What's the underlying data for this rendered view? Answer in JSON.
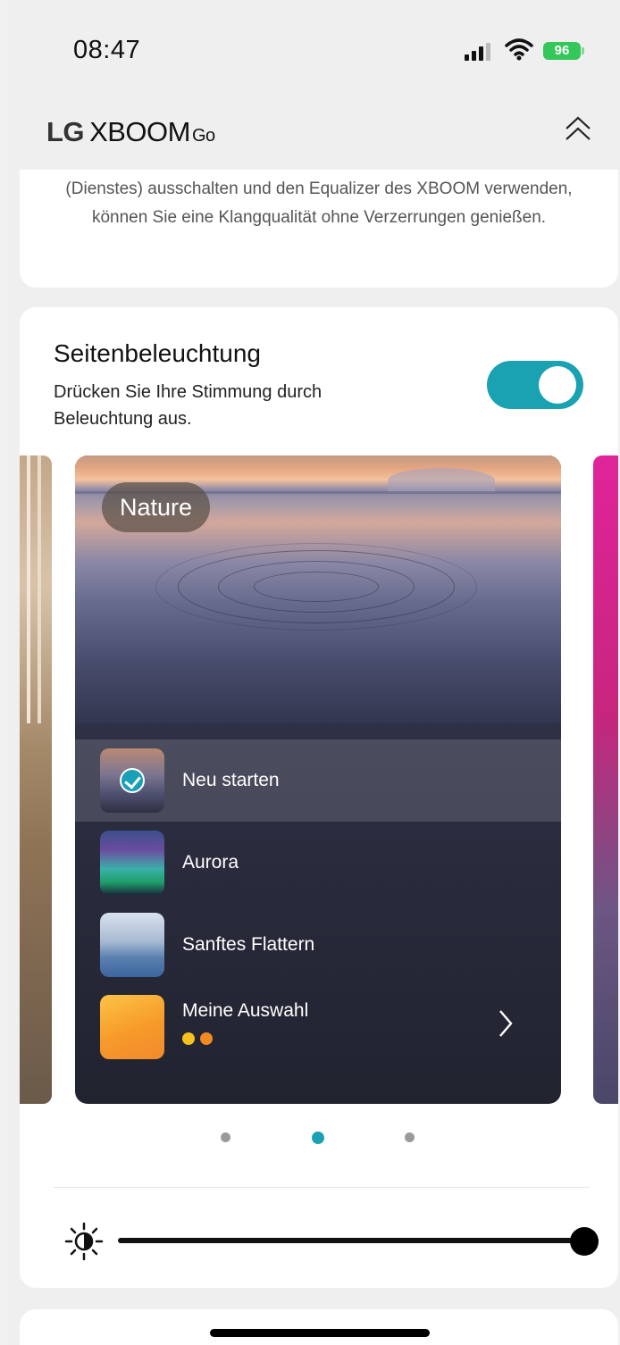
{
  "status_bar": {
    "time": "08:47",
    "battery": "96"
  },
  "header": {
    "brand_lg": "LG",
    "brand_xboom": "XBOOM",
    "brand_go": "Go"
  },
  "info_card": {
    "text": "(Dienstes) ausschalten und den Equalizer des XBOOM verwenden, können Sie eine Klangqualität ohne Verzerrungen genießen."
  },
  "lighting": {
    "title": "Seitenbeleuchtung",
    "description": "Drücken Sie Ihre Stimmung durch Beleuchtung aus.",
    "enabled": true,
    "theme_card": {
      "category": "Nature",
      "items": [
        {
          "label": "Neu starten",
          "selected": true,
          "thumb": "ripple-lake"
        },
        {
          "label": "Aurora",
          "selected": false,
          "thumb": "aurora"
        },
        {
          "label": "Sanftes Flattern",
          "selected": false,
          "thumb": "calm-sea"
        },
        {
          "label": "Meine Auswahl",
          "selected": false,
          "thumb": "orange",
          "dot_colors": [
            "#f4c21f",
            "#f08a23"
          ]
        }
      ]
    },
    "pager": {
      "count": 3,
      "active_index": 1
    },
    "brightness_fraction": 1.0
  },
  "colors": {
    "accent": "#1aa2b2",
    "battery": "#34c759"
  }
}
